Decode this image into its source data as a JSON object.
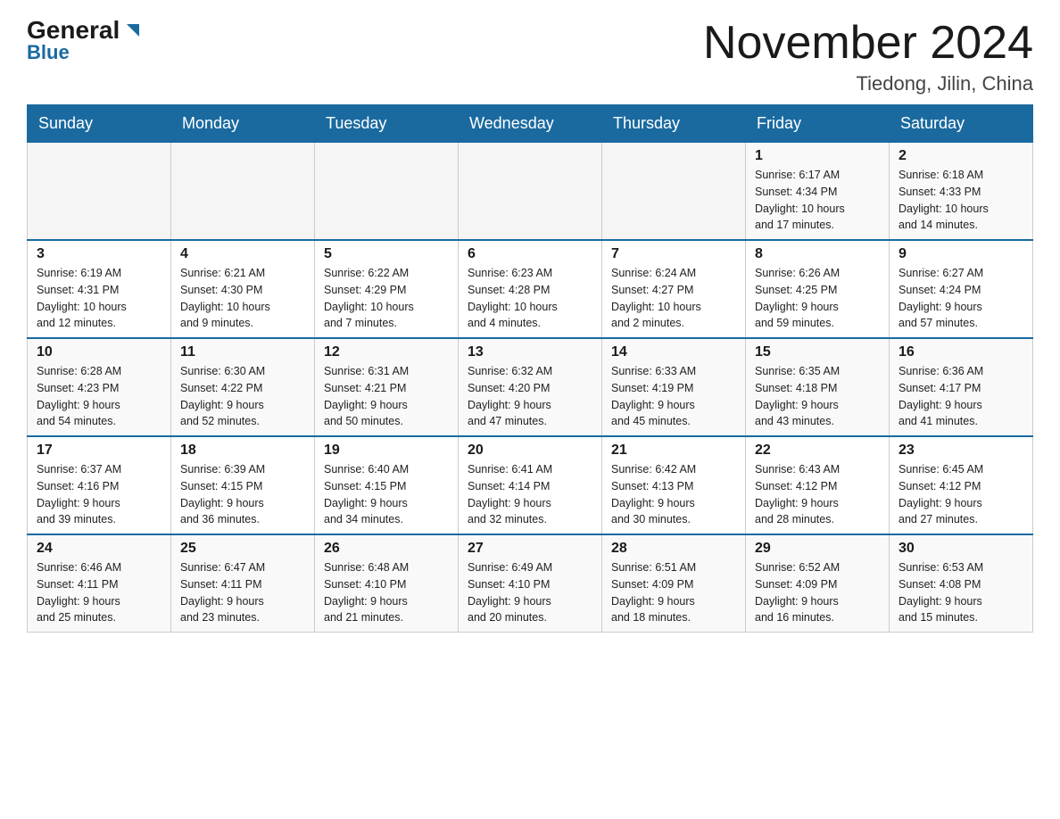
{
  "header": {
    "logo_general": "General",
    "logo_blue": "Blue",
    "month_title": "November 2024",
    "location": "Tiedong, Jilin, China"
  },
  "weekdays": [
    "Sunday",
    "Monday",
    "Tuesday",
    "Wednesday",
    "Thursday",
    "Friday",
    "Saturday"
  ],
  "weeks": [
    {
      "days": [
        {
          "num": "",
          "info": ""
        },
        {
          "num": "",
          "info": ""
        },
        {
          "num": "",
          "info": ""
        },
        {
          "num": "",
          "info": ""
        },
        {
          "num": "",
          "info": ""
        },
        {
          "num": "1",
          "info": "Sunrise: 6:17 AM\nSunset: 4:34 PM\nDaylight: 10 hours\nand 17 minutes."
        },
        {
          "num": "2",
          "info": "Sunrise: 6:18 AM\nSunset: 4:33 PM\nDaylight: 10 hours\nand 14 minutes."
        }
      ]
    },
    {
      "days": [
        {
          "num": "3",
          "info": "Sunrise: 6:19 AM\nSunset: 4:31 PM\nDaylight: 10 hours\nand 12 minutes."
        },
        {
          "num": "4",
          "info": "Sunrise: 6:21 AM\nSunset: 4:30 PM\nDaylight: 10 hours\nand 9 minutes."
        },
        {
          "num": "5",
          "info": "Sunrise: 6:22 AM\nSunset: 4:29 PM\nDaylight: 10 hours\nand 7 minutes."
        },
        {
          "num": "6",
          "info": "Sunrise: 6:23 AM\nSunset: 4:28 PM\nDaylight: 10 hours\nand 4 minutes."
        },
        {
          "num": "7",
          "info": "Sunrise: 6:24 AM\nSunset: 4:27 PM\nDaylight: 10 hours\nand 2 minutes."
        },
        {
          "num": "8",
          "info": "Sunrise: 6:26 AM\nSunset: 4:25 PM\nDaylight: 9 hours\nand 59 minutes."
        },
        {
          "num": "9",
          "info": "Sunrise: 6:27 AM\nSunset: 4:24 PM\nDaylight: 9 hours\nand 57 minutes."
        }
      ]
    },
    {
      "days": [
        {
          "num": "10",
          "info": "Sunrise: 6:28 AM\nSunset: 4:23 PM\nDaylight: 9 hours\nand 54 minutes."
        },
        {
          "num": "11",
          "info": "Sunrise: 6:30 AM\nSunset: 4:22 PM\nDaylight: 9 hours\nand 52 minutes."
        },
        {
          "num": "12",
          "info": "Sunrise: 6:31 AM\nSunset: 4:21 PM\nDaylight: 9 hours\nand 50 minutes."
        },
        {
          "num": "13",
          "info": "Sunrise: 6:32 AM\nSunset: 4:20 PM\nDaylight: 9 hours\nand 47 minutes."
        },
        {
          "num": "14",
          "info": "Sunrise: 6:33 AM\nSunset: 4:19 PM\nDaylight: 9 hours\nand 45 minutes."
        },
        {
          "num": "15",
          "info": "Sunrise: 6:35 AM\nSunset: 4:18 PM\nDaylight: 9 hours\nand 43 minutes."
        },
        {
          "num": "16",
          "info": "Sunrise: 6:36 AM\nSunset: 4:17 PM\nDaylight: 9 hours\nand 41 minutes."
        }
      ]
    },
    {
      "days": [
        {
          "num": "17",
          "info": "Sunrise: 6:37 AM\nSunset: 4:16 PM\nDaylight: 9 hours\nand 39 minutes."
        },
        {
          "num": "18",
          "info": "Sunrise: 6:39 AM\nSunset: 4:15 PM\nDaylight: 9 hours\nand 36 minutes."
        },
        {
          "num": "19",
          "info": "Sunrise: 6:40 AM\nSunset: 4:15 PM\nDaylight: 9 hours\nand 34 minutes."
        },
        {
          "num": "20",
          "info": "Sunrise: 6:41 AM\nSunset: 4:14 PM\nDaylight: 9 hours\nand 32 minutes."
        },
        {
          "num": "21",
          "info": "Sunrise: 6:42 AM\nSunset: 4:13 PM\nDaylight: 9 hours\nand 30 minutes."
        },
        {
          "num": "22",
          "info": "Sunrise: 6:43 AM\nSunset: 4:12 PM\nDaylight: 9 hours\nand 28 minutes."
        },
        {
          "num": "23",
          "info": "Sunrise: 6:45 AM\nSunset: 4:12 PM\nDaylight: 9 hours\nand 27 minutes."
        }
      ]
    },
    {
      "days": [
        {
          "num": "24",
          "info": "Sunrise: 6:46 AM\nSunset: 4:11 PM\nDaylight: 9 hours\nand 25 minutes."
        },
        {
          "num": "25",
          "info": "Sunrise: 6:47 AM\nSunset: 4:11 PM\nDaylight: 9 hours\nand 23 minutes."
        },
        {
          "num": "26",
          "info": "Sunrise: 6:48 AM\nSunset: 4:10 PM\nDaylight: 9 hours\nand 21 minutes."
        },
        {
          "num": "27",
          "info": "Sunrise: 6:49 AM\nSunset: 4:10 PM\nDaylight: 9 hours\nand 20 minutes."
        },
        {
          "num": "28",
          "info": "Sunrise: 6:51 AM\nSunset: 4:09 PM\nDaylight: 9 hours\nand 18 minutes."
        },
        {
          "num": "29",
          "info": "Sunrise: 6:52 AM\nSunset: 4:09 PM\nDaylight: 9 hours\nand 16 minutes."
        },
        {
          "num": "30",
          "info": "Sunrise: 6:53 AM\nSunset: 4:08 PM\nDaylight: 9 hours\nand 15 minutes."
        }
      ]
    }
  ]
}
